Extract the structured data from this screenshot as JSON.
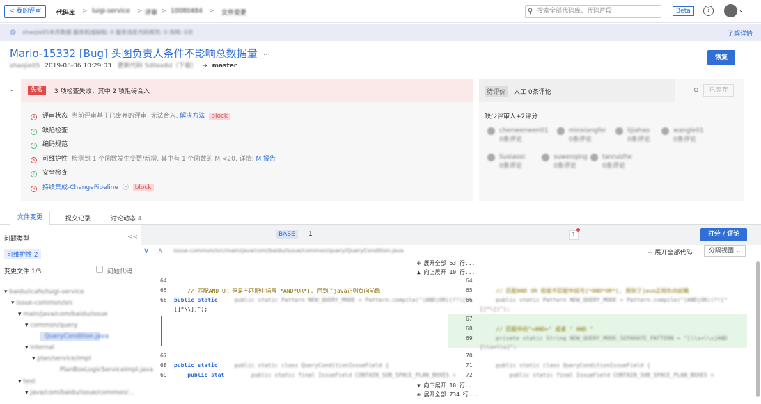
{
  "topbar": {
    "back_label": "< 我的评审",
    "crumbs": [
      "代码库",
      ">",
      "luigi-service",
      ">",
      "评审",
      ">",
      "10080484",
      ">",
      "文件变更"
    ],
    "search_placeholder": "搜索全部代码库、代码片段",
    "beta_label": "Beta",
    "help_icon": "?"
  },
  "notice": {
    "text": "shaojie05本月数据  服务机线缺陷: 0  服务违反代码规范: 0  违规: 0次",
    "link": "了解详情"
  },
  "review": {
    "title": "Mario-15332 [Bug] 头图负责人条件不影响总数据量",
    "more": "···",
    "author": "shaojie05",
    "datetime": "2019-08-06 10:29:03",
    "commit_info": "更新代码 5d0ee8d（下载）",
    "arrow": "→",
    "target_branch": "master",
    "restore_label": "恢复"
  },
  "checks": {
    "fail_badge": "失败",
    "summary": "3 项检查失败，其中 2 项阻碍合入",
    "items": [
      {
        "name": "评审状态",
        "detail": "当前评审基于已废弃的评审, 无法合入,",
        "link": "解决方法",
        "block": "block"
      },
      {
        "name": "缺陷检查",
        "detail": "",
        "link": "",
        "block": ""
      },
      {
        "name": "编码规范",
        "detail": "",
        "link": "",
        "block": ""
      },
      {
        "name": "可维护性",
        "detail": "检测到 1 个函数发生变更/新增, 其中有 1 个函数的 MI<20, 详情:",
        "link": "MI报告",
        "block": ""
      },
      {
        "name": "安全检查",
        "detail": "",
        "link": "",
        "block": ""
      },
      {
        "name": "持续集成-ChangePipeline",
        "detail": "ⓔ",
        "link": "",
        "block": "block"
      }
    ]
  },
  "reviewers": {
    "pending_badge": "待评价",
    "summary": "人工  0条评论",
    "abandoned": "已废弃",
    "missing": "缺少评审人+2评分",
    "people": [
      {
        "name": "chenwenwen01",
        "note": "0条评论"
      },
      {
        "name": "minxiangfei",
        "note": "0条评论"
      },
      {
        "name": "lijiahao",
        "note": "0条评论"
      },
      {
        "name": "wangle01",
        "note": "0条评论"
      },
      {
        "name": "liuxiaoxi",
        "note": "0条评论"
      },
      {
        "name": "suwenqing",
        "note": "0条评论"
      },
      {
        "name": "tanruizhe",
        "note": "0条评论"
      }
    ]
  },
  "tabs": {
    "files": "文件变更",
    "commits": "提交记录",
    "discussion": "讨论动态",
    "discussion_count": "4"
  },
  "left": {
    "issue_type": "问题类型",
    "collapse": "<<",
    "maintainability": "可维护性 2",
    "changed_files": "变更文件 1/3",
    "issue_code": "问题代码",
    "tree": [
      "baidu/icafe/luigi-service",
      "issue-common/src",
      "main/java/com/baidu/issue",
      "common/query",
      "QueryCondition.java",
      "internal",
      "plan/service/impl",
      "PlanBoxLogicServiceImpl.java",
      "test",
      "java/com/baidu/issue/common/..."
    ]
  },
  "diff": {
    "base_label": "BASE",
    "base_num": "1",
    "right_num": "1",
    "score_button": "打分 / 评论",
    "file_path": "issue-common/src/main/java/com/baidu/issue/common/query/QueryCondition.java",
    "expand_all_code": "展开全部代码",
    "view_mode": "分隔视图",
    "expand_all_top": "⊕ 展开全部  63 行...",
    "expand_up": "▲ 向上展开  10 行...",
    "expand_down": "▼ 向下展开  10 行...",
    "expand_all_bottom": "⊕ 展开全部  734 行...",
    "left_lines": [
      "64",
      "65",
      "66",
      "67",
      "68",
      "69"
    ],
    "right_lines": [
      "64",
      "65",
      "66",
      "67",
      "68",
      "69",
      "70",
      "71",
      "72"
    ],
    "left_code_65": "    // 匹配AND OR 但是不匹配中括号[*AND*OR*], 用到了java正则负向前瞻",
    "left_code_66a": "    public static Pattern NEW_QUERY_MODE = Pattern.compile(\"(AND|OR)(?!\\[^\\",
    "left_code_66b": "[]*\\\\])\");",
    "left_code_68": "    public static class QueryConditionIssueField {",
    "left_code_69": "        public static final IssueField CONTAIN_SUB_SPACE_PLAN_BOXES =",
    "right_code_65": "    // 匹配AND OR 但是不匹配中括号[*AND*OR*], 用到了java正则负向前瞻",
    "right_code_66a": "    public static Pattern NEW_QUERY_MODE = Pattern.compile(\"(AND|OR)(?![^",
    "right_code_66b": "[]*\\])\");",
    "right_code_68": "    // 匹配中的\"<AND>\" 或者 \" AND \"",
    "right_code_69a": "    private static String NEW_QUERY_MODE_SEPARATE_PATTERN = \"[\\\\s<\\\\s]AND",
    "right_code_69b": "[\\\\s>\\\\s]\";",
    "right_code_71": "    public static class QueryConditionIssueField {",
    "right_code_72": "        public static final IssueField CONTAIN_SUB_SPACE_PLAN_BOXES ="
  },
  "colors": {
    "accent": "#2f6fd6",
    "fail": "#e04a4a",
    "ok": "#52b36c",
    "added": "#e6f6e6"
  }
}
